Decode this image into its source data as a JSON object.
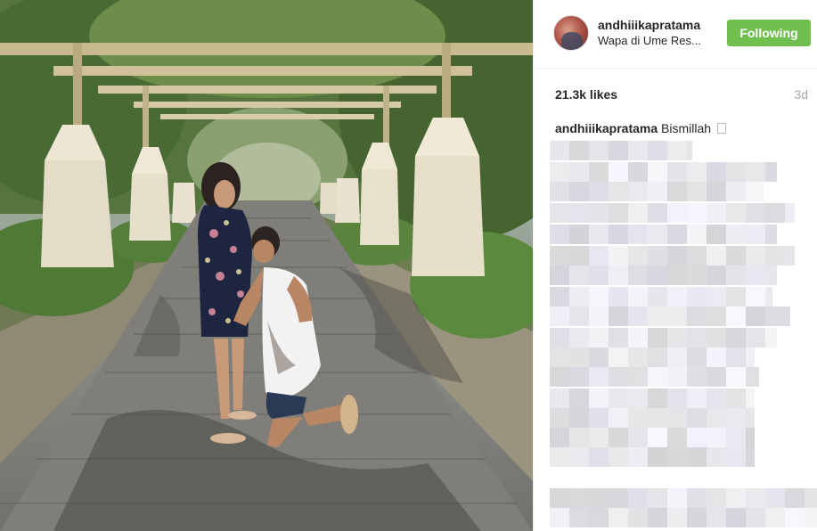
{
  "post": {
    "username": "andhiiikapratama",
    "location": "Wapa di Ume Res...",
    "follow_label": "Following",
    "likes": "21.3k likes",
    "time_ago": "3d",
    "caption_user": "andhiiikapratama",
    "caption_text": "Bismillah"
  },
  "colors": {
    "follow_button": "#70c050",
    "time_text": "#a5a7aa",
    "divider": "#efefef"
  },
  "icons": {
    "caption_emoji": "emoji-placeholder-icon"
  }
}
